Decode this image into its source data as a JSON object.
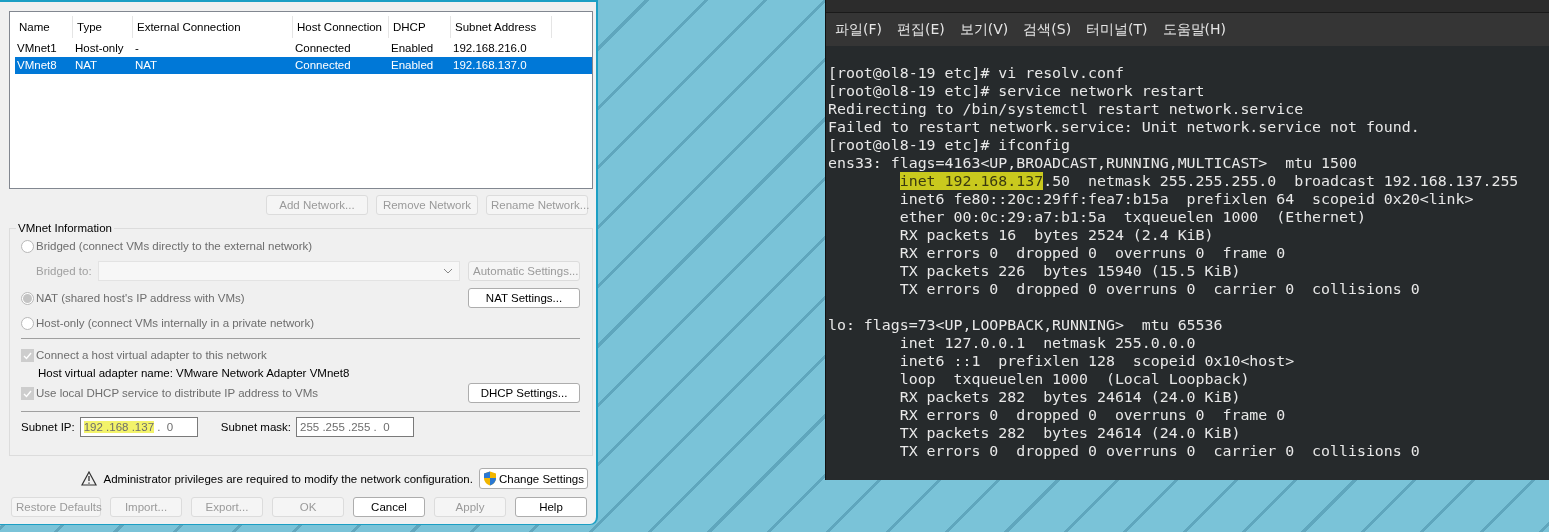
{
  "dialog": {
    "columns": [
      "Name",
      "Type",
      "External Connection",
      "Host Connection",
      "DHCP",
      "Subnet Address"
    ],
    "rows": [
      {
        "cells": [
          "VMnet1",
          "Host-only",
          "-",
          "Connected",
          "Enabled",
          "192.168.216.0"
        ],
        "selected": false
      },
      {
        "cells": [
          "VMnet8",
          "NAT",
          "NAT",
          "Connected",
          "Enabled",
          "192.168.137.0"
        ],
        "selected": true
      }
    ],
    "list_buttons": [
      {
        "label": "Add Network...",
        "disabled": true
      },
      {
        "label": "Remove Network",
        "disabled": true
      },
      {
        "label": "Rename Network...",
        "disabled": true
      }
    ],
    "vmnet_info": {
      "title": "VMnet Information",
      "modes": [
        {
          "label": "Bridged (connect VMs directly to the external network)",
          "selected": false
        },
        {
          "label": "NAT (shared host's IP address with VMs)",
          "selected": true
        },
        {
          "label": "Host-only (connect VMs internally in a private network)",
          "selected": false
        }
      ],
      "bridged_to": "Bridged to:",
      "automatic_settings": {
        "label": "Automatic Settings...",
        "disabled": true
      },
      "nat_settings": {
        "label": "NAT Settings...",
        "disabled": false
      },
      "connect_adapter": {
        "label": "Connect a host virtual adapter to this network",
        "checked": true
      },
      "adapter_name": "Host virtual adapter name: VMware Network Adapter VMnet8",
      "use_dhcp": {
        "label": "Use local DHCP service to distribute IP address to VMs",
        "checked": true
      },
      "dhcp_settings": {
        "label": "DHCP Settings...",
        "disabled": false
      },
      "subnet_ip": {
        "label": "Subnet IP:",
        "segments": [
          {
            "text": "192 .168 .137",
            "highlighted": true
          },
          {
            "text": " .  0",
            "highlighted": false
          }
        ]
      },
      "subnet_mask": {
        "label": "Subnet mask:",
        "segments": [
          {
            "text": "255 .255 .255 .  0",
            "highlighted": false
          }
        ]
      }
    },
    "admin_notice": "Administrator privileges are required to modify the network configuration.",
    "change_settings": "Change Settings",
    "footer_buttons": [
      {
        "label": "Restore Defaults",
        "disabled": true
      },
      {
        "label": "Import...",
        "disabled": true
      },
      {
        "label": "Export...",
        "disabled": true
      },
      {
        "label": "OK",
        "disabled": true
      },
      {
        "label": "Cancel",
        "disabled": false
      },
      {
        "label": "Apply",
        "disabled": true
      },
      {
        "label": "Help",
        "disabled": false
      }
    ]
  },
  "terminal": {
    "menu": [
      "파일(F)",
      "편집(E)",
      "보기(V)",
      "검색(S)",
      "터미널(T)",
      "도움말(H)"
    ],
    "blocks": [
      [
        {
          "indented": false,
          "segments": [
            {
              "text": "[root@ol8-19 etc]# vi resolv.conf",
              "highlighted": false
            }
          ]
        },
        {
          "indented": false,
          "segments": [
            {
              "text": "[root@ol8-19 etc]# service network restart",
              "highlighted": false
            }
          ]
        },
        {
          "indented": false,
          "segments": [
            {
              "text": "Redirecting to /bin/systemctl restart network.service",
              "highlighted": false
            }
          ]
        },
        {
          "indented": false,
          "segments": [
            {
              "text": "Failed to restart network.service: Unit network.service not found.",
              "highlighted": false
            }
          ]
        },
        {
          "indented": false,
          "segments": [
            {
              "text": "[root@ol8-19 etc]# ifconfig",
              "highlighted": false
            }
          ]
        },
        {
          "indented": false,
          "segments": [
            {
              "text": "ens33: flags=4163<UP,BROADCAST,RUNNING,MULTICAST>  mtu 1500",
              "highlighted": false
            }
          ]
        },
        {
          "indented": true,
          "segments": [
            {
              "text": "inet 192.168.137",
              "highlighted": true
            },
            {
              "text": ".50  netmask 255.255.255.0  broadcast 192.168.137.255",
              "highlighted": false
            }
          ]
        },
        {
          "indented": true,
          "segments": [
            {
              "text": "inet6 fe80::20c:29ff:fea7:b15a  prefixlen 64  scopeid 0x20<link>",
              "highlighted": false
            }
          ]
        },
        {
          "indented": true,
          "segments": [
            {
              "text": "ether 00:0c:29:a7:b1:5a  txqueuelen 1000  (Ethernet)",
              "highlighted": false
            }
          ]
        },
        {
          "indented": true,
          "segments": [
            {
              "text": "RX packets 16  bytes 2524 (2.4 KiB)",
              "highlighted": false
            }
          ]
        },
        {
          "indented": true,
          "segments": [
            {
              "text": "RX errors 0  dropped 0  overruns 0  frame 0",
              "highlighted": false
            }
          ]
        },
        {
          "indented": true,
          "segments": [
            {
              "text": "TX packets 226  bytes 15940 (15.5 KiB)",
              "highlighted": false
            }
          ]
        },
        {
          "indented": true,
          "segments": [
            {
              "text": "TX errors 0  dropped 0 overruns 0  carrier 0  collisions 0",
              "highlighted": false
            }
          ]
        }
      ],
      [
        {
          "indented": false,
          "segments": [
            {
              "text": "lo: flags=73<UP,LOOPBACK,RUNNING>  mtu 65536",
              "highlighted": false
            }
          ]
        },
        {
          "indented": true,
          "segments": [
            {
              "text": "inet 127.0.0.1  netmask 255.0.0.0",
              "highlighted": false
            }
          ]
        },
        {
          "indented": true,
          "segments": [
            {
              "text": "inet6 ::1  prefixlen 128  scopeid 0x10<host>",
              "highlighted": false
            }
          ]
        },
        {
          "indented": true,
          "segments": [
            {
              "text": "loop  txqueuelen 1000  (Local Loopback)",
              "highlighted": false
            }
          ]
        },
        {
          "indented": true,
          "segments": [
            {
              "text": "RX packets 282  bytes 24614 (24.0 KiB)",
              "highlighted": false
            }
          ]
        },
        {
          "indented": true,
          "segments": [
            {
              "text": "RX errors 0  dropped 0  overruns 0  frame 0",
              "highlighted": false
            }
          ]
        },
        {
          "indented": true,
          "segments": [
            {
              "text": "TX packets 282  bytes 24614 (24.0 KiB)",
              "highlighted": false
            }
          ]
        },
        {
          "indented": true,
          "segments": [
            {
              "text": "TX errors 0  dropped 0 overruns 0  carrier 0  collisions 0",
              "highlighted": false
            }
          ]
        }
      ]
    ]
  }
}
